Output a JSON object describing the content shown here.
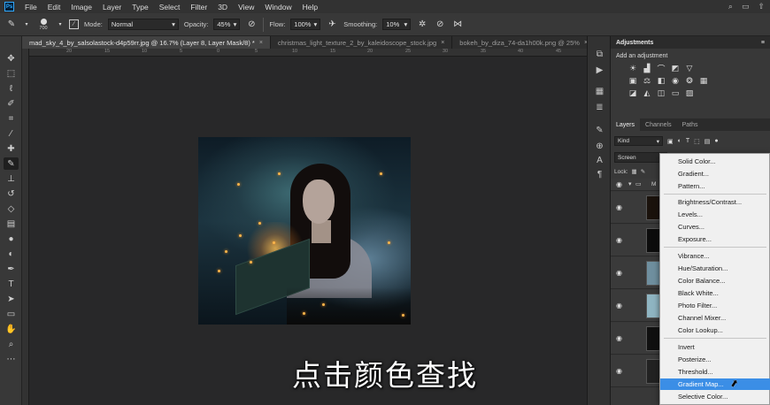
{
  "menubar": {
    "logo": "Ps",
    "items": [
      "File",
      "Edit",
      "Image",
      "Layer",
      "Type",
      "Select",
      "Filter",
      "3D",
      "View",
      "Window",
      "Help"
    ],
    "right_icons": [
      "search-icon",
      "workspace-icon",
      "share-icon"
    ]
  },
  "options": {
    "brush_size": "700",
    "mode_label": "Mode:",
    "mode_value": "Normal",
    "opacity_label": "Opacity:",
    "opacity_value": "45%",
    "flow_label": "Flow:",
    "flow_value": "100%",
    "smoothing_label": "Smoothing:",
    "smoothing_value": "10%"
  },
  "tabs": [
    {
      "label": "mad_sky_4_by_salsolastock-d4p59rr.jpg @ 16.7% (Layer 8, Layer Mask/8) *",
      "active": true
    },
    {
      "label": "christmas_light_texture_2_by_kaleidoscope_stock.jpg",
      "active": false
    },
    {
      "label": "bokeh_by_diza_74-da1h00k.png @ 25%",
      "active": false
    }
  ],
  "ruler": [
    "20",
    "15",
    "10",
    "5",
    "0",
    "5",
    "10",
    "15",
    "20",
    "25",
    "30",
    "35",
    "40",
    "45"
  ],
  "subtitle": "点击颜色查找",
  "adjustments": {
    "title": "Adjustments",
    "subtitle": "Add an adjustment"
  },
  "layers": {
    "tabs": [
      "Layers",
      "Channels",
      "Paths"
    ],
    "kind_label": "Kind",
    "blend_mode": "Screen",
    "lock_label": "Lock:",
    "group_label": "M"
  },
  "menu": {
    "groups": [
      [
        "Solid Color...",
        "Gradient...",
        "Pattern..."
      ],
      [
        "Brightness/Contrast...",
        "Levels...",
        "Curves...",
        "Exposure..."
      ],
      [
        "Vibrance...",
        "Hue/Saturation...",
        "Color Balance...",
        "Black  White...",
        "Photo Filter...",
        "Channel Mixer...",
        "Color Lookup..."
      ],
      [
        "Invert",
        "Posterize...",
        "Threshold...",
        "Gradient Map...",
        "Selective Color..."
      ]
    ],
    "highlighted": "Gradient Map..."
  },
  "colors": {
    "accent": "#3b8ee6",
    "foreground": "#000000",
    "background": "#ffffff"
  }
}
